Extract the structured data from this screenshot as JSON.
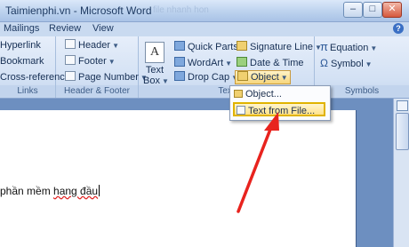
{
  "window": {
    "title": "Taimienphi.vn - Microsoft Word",
    "blurred_title": "file nhanh hon"
  },
  "tabs": [
    "Mailings",
    "Review",
    "View"
  ],
  "ribbon": {
    "links": {
      "items": [
        "Hyperlink",
        "Bookmark",
        "Cross-reference"
      ],
      "label": "Links"
    },
    "header_footer": {
      "items": [
        "Header",
        "Footer",
        "Page Number"
      ],
      "label": "Header & Footer"
    },
    "text": {
      "textbox_label_1": "Text",
      "textbox_label_2": "Box",
      "textbox_icon": "A",
      "col2": [
        "Quick Parts",
        "WordArt",
        "Drop Cap"
      ],
      "col3": [
        "Signature Line",
        "Date & Time",
        "Object"
      ],
      "label": "Text"
    },
    "symbols": {
      "items": [
        "Equation",
        "Symbol"
      ],
      "pi_glyph": "π",
      "omega_glyph": "Ω",
      "label": "Symbols"
    }
  },
  "dropdown": {
    "items": [
      "Object...",
      "Text from File..."
    ]
  },
  "document": {
    "text_plain": "phần mềm ",
    "text_squiggle": "hang đầu"
  },
  "colors": {
    "accent": "#e0b300",
    "arrow": "#e8231e"
  }
}
